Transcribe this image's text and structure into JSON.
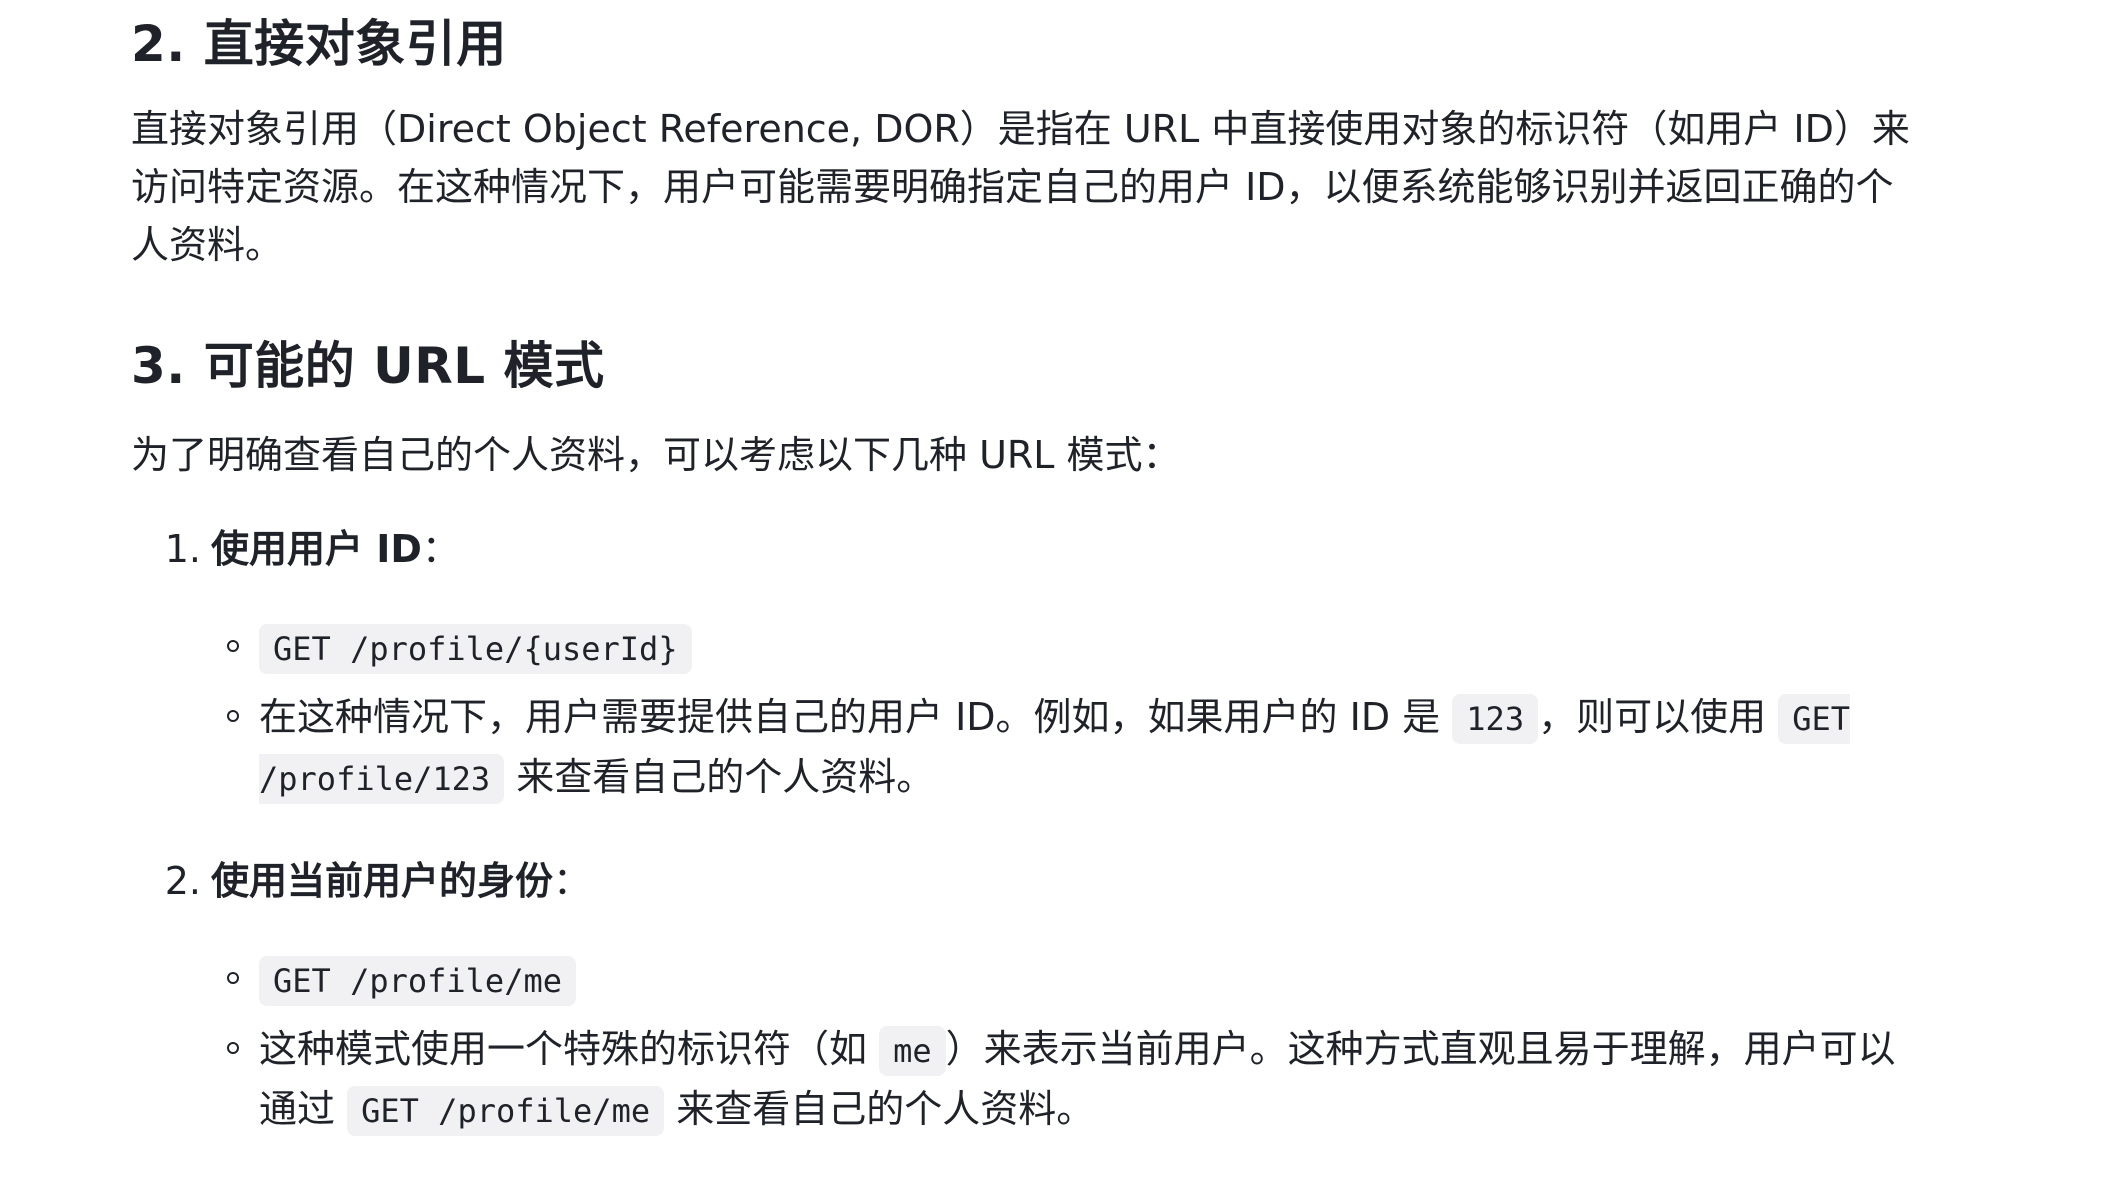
{
  "section2": {
    "heading": "2. 直接对象引用",
    "paragraph": "直接对象引用（Direct Object Reference, DOR）是指在 URL 中直接使用对象的标识符（如用户 ID）来访问特定资源。在这种情况下，用户可能需要明确指定自己的用户 ID，以便系统能够识别并返回正确的个人资料。"
  },
  "section3": {
    "heading": "3. 可能的 URL 模式",
    "intro": "为了明确查看自己的个人资料，可以考虑以下几种 URL 模式：",
    "items": [
      {
        "number": "1.",
        "title": "使用用户 ID",
        "colon": "：",
        "code": "GET /profile/{userId}",
        "desc_before": "在这种情况下，用户需要提供自己的用户 ID。例如，如果用户的 ID 是",
        "desc_code1": "123",
        "desc_mid": "，则可以使用",
        "desc_code2": "GET /profile/123",
        "desc_after": "来查看自己的个人资料。"
      },
      {
        "number": "2.",
        "title": "使用当前用户的身份",
        "colon": "：",
        "code": "GET /profile/me",
        "desc_before": "这种模式使用一个特殊的标识符（如",
        "desc_code1": "me",
        "desc_mid": "）来表示当前用户。这种方式直观且易于理解，用户可以通过",
        "desc_code2": "GET /profile/me",
        "desc_after": "来查看自己的个人资料。"
      }
    ]
  }
}
